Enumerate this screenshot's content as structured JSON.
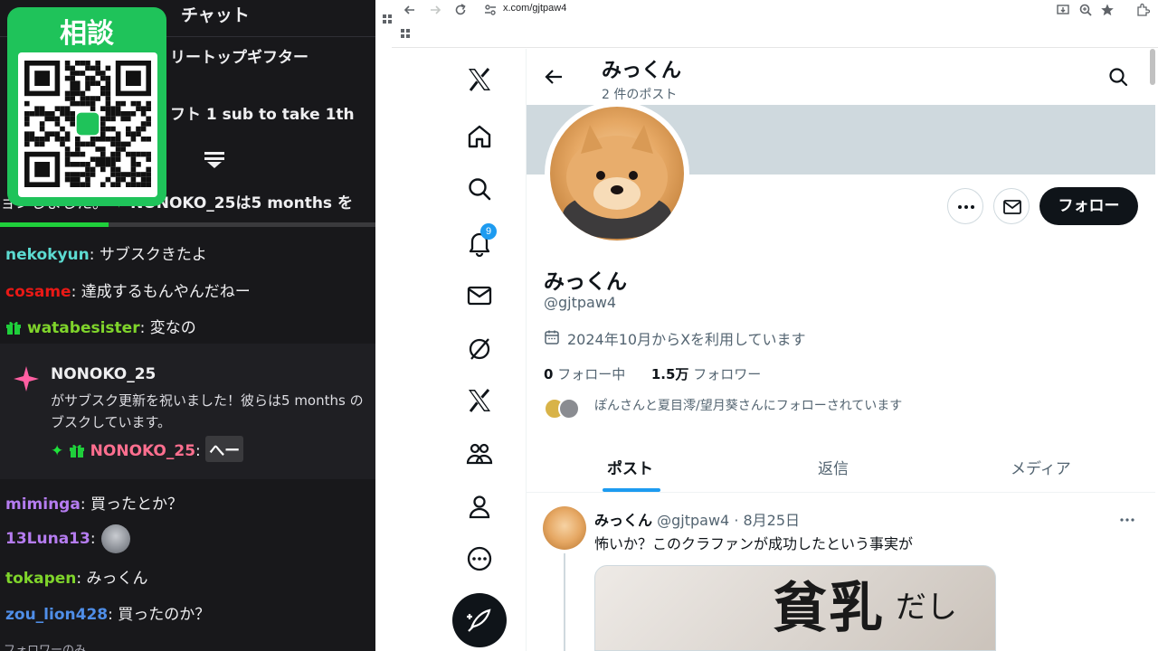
{
  "chat": {
    "title": "チャット",
    "gift_line_1": "リートップギフター",
    "gift_line_2": "フト 1 sub to take 1th",
    "sub_banner": {
      "prefix": "ョンしました。",
      "user": "NONOKO_25",
      "suffix": "は5 months を"
    },
    "progress_fraction": 0.29,
    "messages_top": [
      {
        "user": "nekokyun",
        "color": "#5cdbd1",
        "text": ": サブスクきたよ"
      },
      {
        "user": "cosame",
        "color": "#e91916",
        "text": ": 達成するもんやんだねー"
      },
      {
        "user": "watabesister",
        "color": "#7fd42b",
        "text": ": 変なの"
      }
    ],
    "resub": {
      "user": "NONOKO_25",
      "line1": "がサブスク更新を祝いました！彼らは5 months の",
      "line2": "ブスクしています。",
      "reply_user": "NONOKO_25",
      "reply_user_color": "#ff6f8f",
      "reply_text": "へー"
    },
    "messages_bottom": [
      {
        "user": "miminga",
        "color": "#b57cf0",
        "text": ": 買ったとか？"
      },
      {
        "user": "13Luna13",
        "color": "#b57cf0",
        "text": ":"
      },
      {
        "user": "tokapen",
        "color": "#7fd42b",
        "text": ": みっくん"
      },
      {
        "user": "zou_lion428",
        "color": "#4f8ee8",
        "text": ": 買ったのか？"
      }
    ],
    "bottom_hint": "フォロワーのみ"
  },
  "qr": {
    "label": "相談",
    "color": "#1fc35a"
  },
  "browser": {
    "url": "x.com/gjtpaw4"
  },
  "x": {
    "notification_count": "9",
    "header": {
      "name": "みっくん",
      "post_count": "2 件のポスト"
    },
    "profile": {
      "name": "みっくん",
      "handle": "@gjtpaw4",
      "joined": "2024年10月からXを利用しています",
      "following_count": "0",
      "following_label": "フォロー中",
      "followers_count": "1.5万",
      "followers_label": "フォロワー",
      "followed_by": "ぽんさんと夏目澪/望月葵さんにフォローされています",
      "follow_button": "フォロー"
    },
    "tabs": [
      {
        "label": "ポスト",
        "active": true
      },
      {
        "label": "返信",
        "active": false
      },
      {
        "label": "メディア",
        "active": false
      }
    ],
    "post": {
      "name": "みっくん",
      "handle": "@gjtpaw4",
      "date": "· 8月25日",
      "text": "怖いか？このクラファンが成功したという事実が",
      "image_text_big": "貧乳",
      "image_text_small": "だし"
    },
    "accent": "#1d9bf0"
  }
}
